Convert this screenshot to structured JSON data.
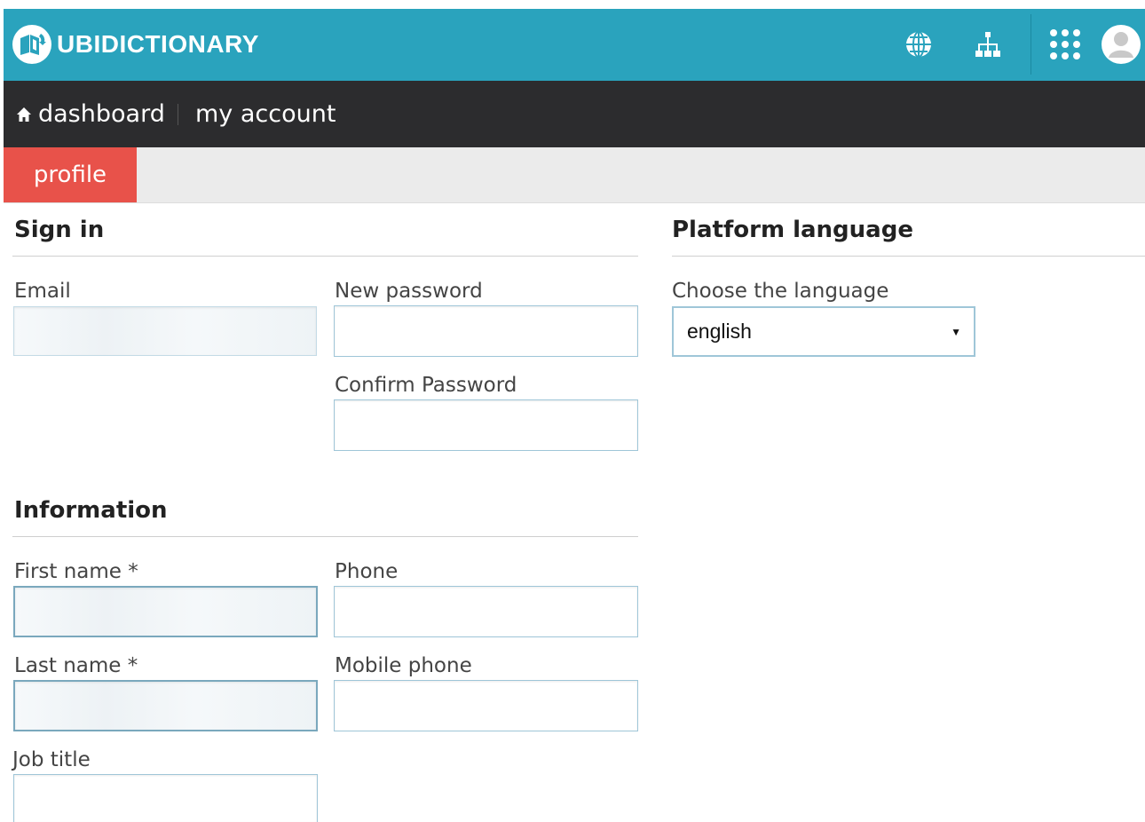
{
  "header": {
    "brand": "UBIDICTIONARY",
    "icons": [
      "globe-icon",
      "sitemap-icon",
      "apps-grid-icon",
      "user-avatar-icon"
    ],
    "color": "#2aa3bd"
  },
  "nav": {
    "dashboard": "dashboard",
    "my_account": "my account"
  },
  "tabs": {
    "profile": "profile",
    "active_color": "#e8524a"
  },
  "sign_in": {
    "title": "Sign in",
    "email_label": "Email",
    "new_password_label": "New password",
    "confirm_password_label": "Confirm Password"
  },
  "platform_language": {
    "title": "Platform language",
    "choose_label": "Choose the language",
    "selected": "english"
  },
  "information": {
    "title": "Information",
    "first_name_label": "First name *",
    "phone_label": "Phone",
    "last_name_label": "Last name *",
    "mobile_phone_label": "Mobile phone",
    "job_title_label": "Job title"
  }
}
